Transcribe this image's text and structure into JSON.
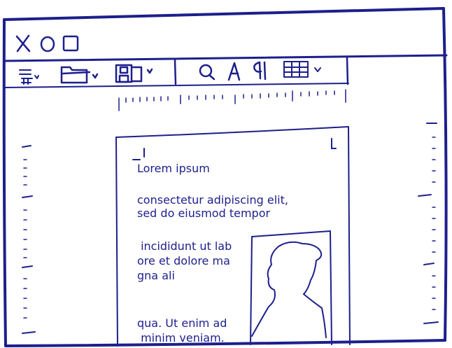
{
  "ink_color": "#1d1f8c",
  "window": {
    "title_buttons": [
      "close-icon",
      "circle-icon",
      "square-icon"
    ]
  },
  "toolbar": {
    "icons": [
      "text-lines-icon",
      "folder-icon",
      "save-icon",
      "search-icon",
      "font-a-icon",
      "paragraph-icon",
      "table-icon"
    ]
  },
  "document": {
    "heading": "Lorem ipsum",
    "para1_line1": "consectetur adipiscing elit,",
    "para1_line2": "sed do eiusmod tempor",
    "para2_line1": " incididunt ut lab",
    "para2_line2": "ore et dolore ma",
    "para2_line3": "gna ali",
    "para3_line1": "qua. Ut enim ad",
    "para3_line2": " minim veniam."
  }
}
